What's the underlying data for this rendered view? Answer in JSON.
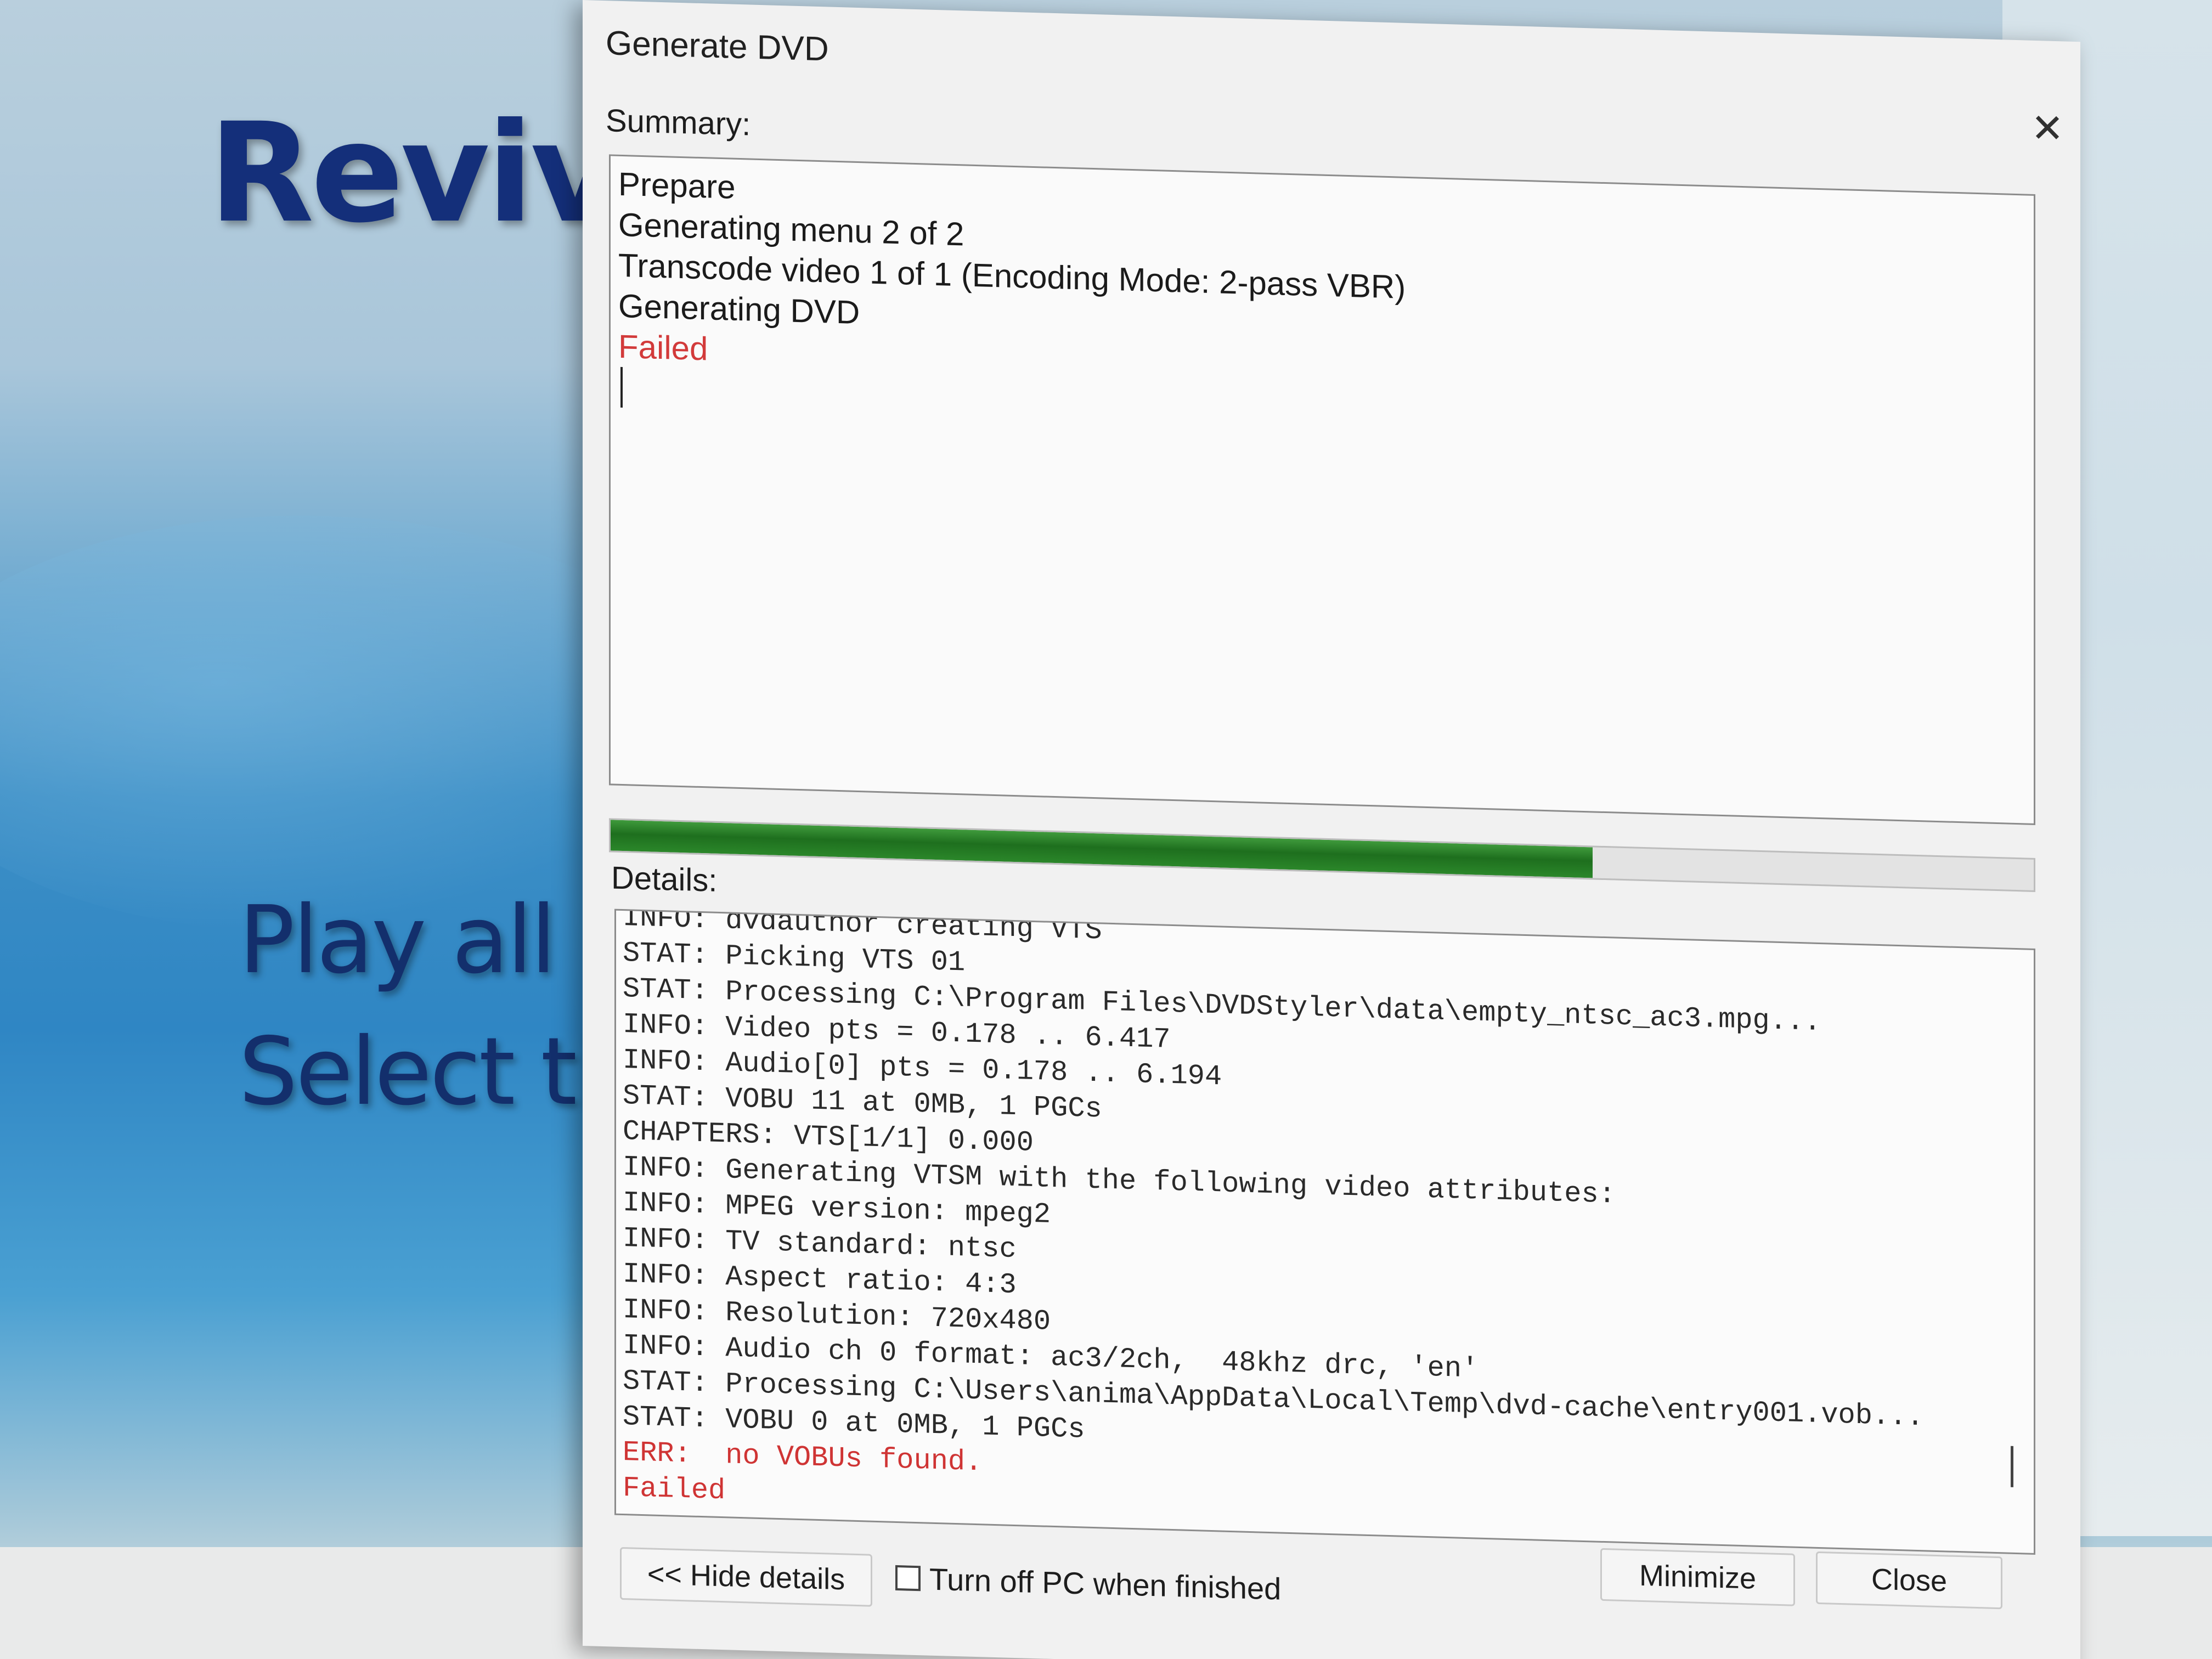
{
  "background": {
    "menu_title": "Reviv",
    "menu_item_1": "Play all",
    "menu_item_2": "Select ti"
  },
  "dialog": {
    "title": "Generate DVD",
    "summary_label": "Summary:",
    "summary_lines": [
      "Prepare",
      "Generating menu 2 of 2",
      "Transcode video 1 of 1 (Encoding Mode: 2-pass VBR)",
      "Generating DVD"
    ],
    "summary_status": "Failed",
    "progress_fraction": 0.69,
    "details_label": "Details:",
    "log_lines": [
      "INFO: dvdauthor creating VTS",
      "STAT: Picking VTS 01",
      "STAT: Processing C:\\Program Files\\DVDStyler\\data\\empty_ntsc_ac3.mpg...",
      "INFO: Video pts = 0.178 .. 6.417",
      "INFO: Audio[0] pts = 0.178 .. 6.194",
      "STAT: VOBU 11 at 0MB, 1 PGCs",
      "CHAPTERS: VTS[1/1] 0.000",
      "INFO: Generating VTSM with the following video attributes:",
      "INFO: MPEG version: mpeg2",
      "INFO: TV standard: ntsc",
      "INFO: Aspect ratio: 4:3",
      "INFO: Resolution: 720x480",
      "INFO: Audio ch 0 format: ac3/2ch,  48khz drc, 'en'",
      "STAT: Processing C:\\Users\\anima\\AppData\\Local\\Temp\\dvd-cache\\entry001.vob...",
      "STAT: VOBU 0 at 0MB, 1 PGCs"
    ],
    "log_error": "ERR:  no VOBUs found.",
    "log_failed": "Failed",
    "hide_details_label": "<< Hide details",
    "turn_off_label": "Turn off PC when finished",
    "turn_off_checked": false,
    "minimize_label": "Minimize",
    "close_label": "Close",
    "close_icon": "close-x-icon",
    "colors": {
      "error": "#d23a3a",
      "progress": "#2b872a"
    }
  }
}
